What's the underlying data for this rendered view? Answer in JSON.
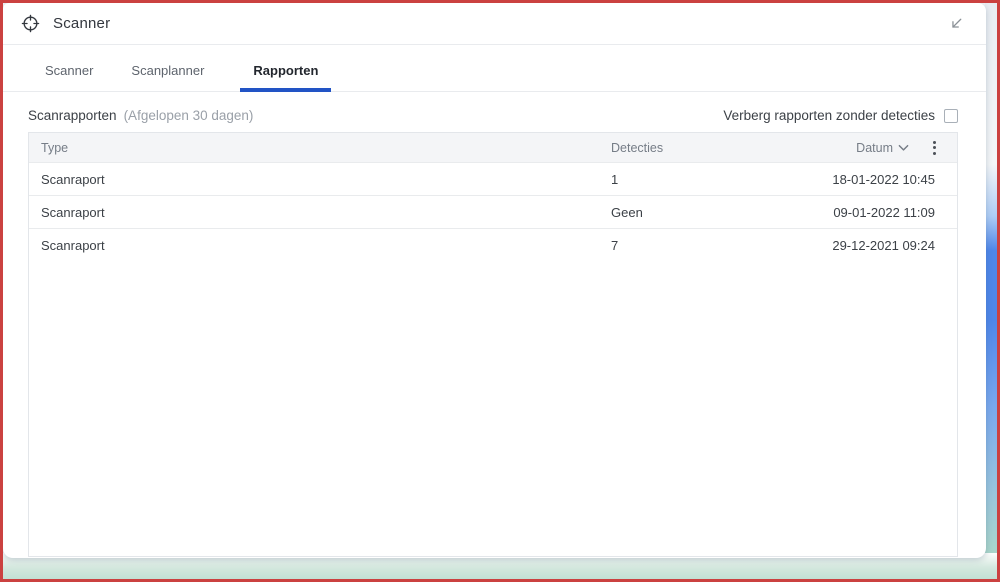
{
  "window": {
    "title": "Scanner"
  },
  "tabs": [
    {
      "label": "Scanner",
      "active": false
    },
    {
      "label": "Scanplanner",
      "active": false
    },
    {
      "label": "Rapporten",
      "active": true
    }
  ],
  "section": {
    "title": "Scanrapporten",
    "subtitle": "(Afgelopen 30 dagen)",
    "filter_label": "Verberg rapporten zonder detecties",
    "filter_checked": false
  },
  "table": {
    "columns": [
      "Type",
      "Detecties",
      "Datum"
    ],
    "sort_column": "Datum",
    "sort_direction": "desc",
    "rows": [
      {
        "type": "Scanraport",
        "detecties": "1",
        "datum": "18-01-2022 10:45"
      },
      {
        "type": "Scanraport",
        "detecties": "Geen",
        "datum": "09-01-2022 11:09"
      },
      {
        "type": "Scanraport",
        "detecties": "7",
        "datum": "29-12-2021 09:24"
      }
    ]
  },
  "icons": {
    "target": "scan-target-icon",
    "collapse": "arrow-down-left-icon",
    "sort": "chevron-down-icon",
    "menu": "kebab-menu-icon"
  },
  "colors": {
    "accent_blue": "#2254c5",
    "frame_red": "#cb4140",
    "header_bg": "#f4f5f7",
    "bottom_teal": "#c2e0d4",
    "side_blue": "#4e86ea"
  }
}
